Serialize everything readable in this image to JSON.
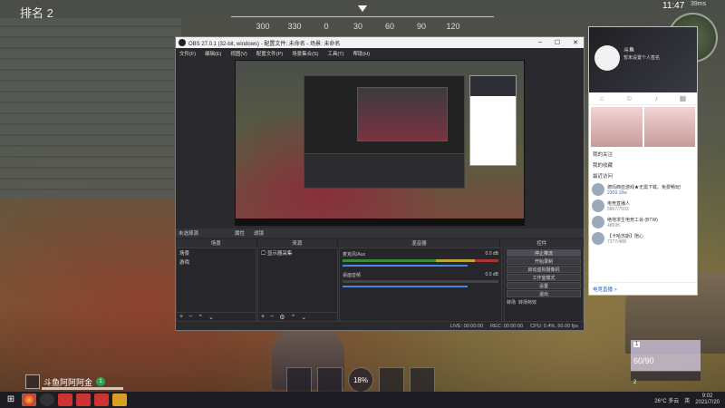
{
  "hud": {
    "rank": "排名 2",
    "compass": [
      "300",
      "330",
      "0",
      "30",
      "60",
      "90",
      "120"
    ],
    "clock": "11:47",
    "battery": "39ms"
  },
  "obs": {
    "title": "OBS 27.0.1 (32-bit, windows) - 配置文件: 未命名 - 场景: 未命名",
    "menu": [
      "文件(F)",
      "编辑(E)",
      "视图(V)",
      "配置文件(P)",
      "场景集合(S)",
      "工具(T)",
      "帮助(H)"
    ],
    "scene_label": "未选择源",
    "props_button": "属性",
    "filters_button": "滤镜",
    "docks": [
      "场景",
      "来源",
      "混音器",
      "转场",
      "控件"
    ],
    "scenes": [
      "场景",
      "游戏"
    ],
    "sources": [
      "显示器采集"
    ],
    "mixer": [
      {
        "name": "麦克风/Aux",
        "level": "0.0 dB"
      },
      {
        "name": "桌面音频",
        "level": "0.0 dB"
      }
    ],
    "controls": [
      "停止推流",
      "开始录制",
      "启动虚拟摄像机",
      "工作室模式",
      "设置",
      "退出"
    ],
    "transition": [
      "转场",
      "转场特效"
    ],
    "status": [
      "LIVE: 00:00:00",
      "REC: 00:00:00",
      "CPU: 0.4%, 60.00 fps"
    ]
  },
  "side_panel": {
    "user": "斗鱼",
    "subtitle": "暂未设置个人签名",
    "links": [
      "我的关注",
      "我的收藏",
      "最近访问"
    ],
    "items": [
      {
        "name": "德玛西亚游戏★无需下载、免费畅玩!",
        "meta": "2309.18w"
      },
      {
        "name": "电竞直播人",
        "meta": "5807/7503"
      },
      {
        "name": "绝地求生电竞工会 (BTW)",
        "meta": "48695"
      },
      {
        "name": "【卡哈苏斯】陪心",
        "meta": "7377/488"
      }
    ],
    "footer": "电竞直播 >"
  },
  "player": {
    "name": "斗鱼阿阿阿金",
    "level": "1"
  },
  "skills": {
    "center_value": "18%"
  },
  "weapon": {
    "slot1": "1",
    "ammo": "60/90",
    "slot2": "2"
  },
  "taskbar": {
    "weather": "26°C 多云",
    "time": "9:02",
    "date": "2021/7/20",
    "ime": "英"
  }
}
